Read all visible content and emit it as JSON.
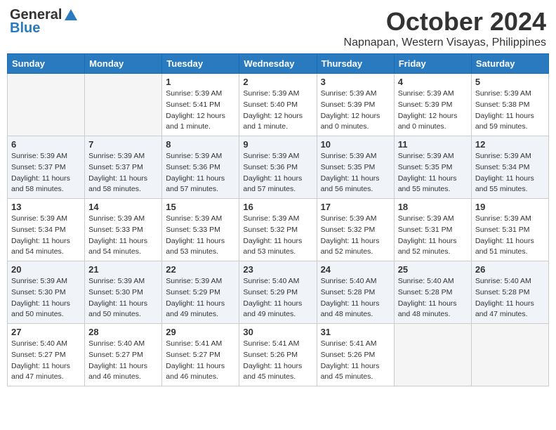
{
  "logo": {
    "line1": "General",
    "line2": "Blue"
  },
  "title": "October 2024",
  "subtitle": "Napnapan, Western Visayas, Philippines",
  "weekdays": [
    "Sunday",
    "Monday",
    "Tuesday",
    "Wednesday",
    "Thursday",
    "Friday",
    "Saturday"
  ],
  "weeks": [
    [
      {
        "day": "",
        "sunrise": "",
        "sunset": "",
        "daylight": ""
      },
      {
        "day": "",
        "sunrise": "",
        "sunset": "",
        "daylight": ""
      },
      {
        "day": "1",
        "sunrise": "Sunrise: 5:39 AM",
        "sunset": "Sunset: 5:41 PM",
        "daylight": "Daylight: 12 hours and 1 minute."
      },
      {
        "day": "2",
        "sunrise": "Sunrise: 5:39 AM",
        "sunset": "Sunset: 5:40 PM",
        "daylight": "Daylight: 12 hours and 1 minute."
      },
      {
        "day": "3",
        "sunrise": "Sunrise: 5:39 AM",
        "sunset": "Sunset: 5:39 PM",
        "daylight": "Daylight: 12 hours and 0 minutes."
      },
      {
        "day": "4",
        "sunrise": "Sunrise: 5:39 AM",
        "sunset": "Sunset: 5:39 PM",
        "daylight": "Daylight: 12 hours and 0 minutes."
      },
      {
        "day": "5",
        "sunrise": "Sunrise: 5:39 AM",
        "sunset": "Sunset: 5:38 PM",
        "daylight": "Daylight: 11 hours and 59 minutes."
      }
    ],
    [
      {
        "day": "6",
        "sunrise": "Sunrise: 5:39 AM",
        "sunset": "Sunset: 5:37 PM",
        "daylight": "Daylight: 11 hours and 58 minutes."
      },
      {
        "day": "7",
        "sunrise": "Sunrise: 5:39 AM",
        "sunset": "Sunset: 5:37 PM",
        "daylight": "Daylight: 11 hours and 58 minutes."
      },
      {
        "day": "8",
        "sunrise": "Sunrise: 5:39 AM",
        "sunset": "Sunset: 5:36 PM",
        "daylight": "Daylight: 11 hours and 57 minutes."
      },
      {
        "day": "9",
        "sunrise": "Sunrise: 5:39 AM",
        "sunset": "Sunset: 5:36 PM",
        "daylight": "Daylight: 11 hours and 57 minutes."
      },
      {
        "day": "10",
        "sunrise": "Sunrise: 5:39 AM",
        "sunset": "Sunset: 5:35 PM",
        "daylight": "Daylight: 11 hours and 56 minutes."
      },
      {
        "day": "11",
        "sunrise": "Sunrise: 5:39 AM",
        "sunset": "Sunset: 5:35 PM",
        "daylight": "Daylight: 11 hours and 55 minutes."
      },
      {
        "day": "12",
        "sunrise": "Sunrise: 5:39 AM",
        "sunset": "Sunset: 5:34 PM",
        "daylight": "Daylight: 11 hours and 55 minutes."
      }
    ],
    [
      {
        "day": "13",
        "sunrise": "Sunrise: 5:39 AM",
        "sunset": "Sunset: 5:34 PM",
        "daylight": "Daylight: 11 hours and 54 minutes."
      },
      {
        "day": "14",
        "sunrise": "Sunrise: 5:39 AM",
        "sunset": "Sunset: 5:33 PM",
        "daylight": "Daylight: 11 hours and 54 minutes."
      },
      {
        "day": "15",
        "sunrise": "Sunrise: 5:39 AM",
        "sunset": "Sunset: 5:33 PM",
        "daylight": "Daylight: 11 hours and 53 minutes."
      },
      {
        "day": "16",
        "sunrise": "Sunrise: 5:39 AM",
        "sunset": "Sunset: 5:32 PM",
        "daylight": "Daylight: 11 hours and 53 minutes."
      },
      {
        "day": "17",
        "sunrise": "Sunrise: 5:39 AM",
        "sunset": "Sunset: 5:32 PM",
        "daylight": "Daylight: 11 hours and 52 minutes."
      },
      {
        "day": "18",
        "sunrise": "Sunrise: 5:39 AM",
        "sunset": "Sunset: 5:31 PM",
        "daylight": "Daylight: 11 hours and 52 minutes."
      },
      {
        "day": "19",
        "sunrise": "Sunrise: 5:39 AM",
        "sunset": "Sunset: 5:31 PM",
        "daylight": "Daylight: 11 hours and 51 minutes."
      }
    ],
    [
      {
        "day": "20",
        "sunrise": "Sunrise: 5:39 AM",
        "sunset": "Sunset: 5:30 PM",
        "daylight": "Daylight: 11 hours and 50 minutes."
      },
      {
        "day": "21",
        "sunrise": "Sunrise: 5:39 AM",
        "sunset": "Sunset: 5:30 PM",
        "daylight": "Daylight: 11 hours and 50 minutes."
      },
      {
        "day": "22",
        "sunrise": "Sunrise: 5:39 AM",
        "sunset": "Sunset: 5:29 PM",
        "daylight": "Daylight: 11 hours and 49 minutes."
      },
      {
        "day": "23",
        "sunrise": "Sunrise: 5:40 AM",
        "sunset": "Sunset: 5:29 PM",
        "daylight": "Daylight: 11 hours and 49 minutes."
      },
      {
        "day": "24",
        "sunrise": "Sunrise: 5:40 AM",
        "sunset": "Sunset: 5:28 PM",
        "daylight": "Daylight: 11 hours and 48 minutes."
      },
      {
        "day": "25",
        "sunrise": "Sunrise: 5:40 AM",
        "sunset": "Sunset: 5:28 PM",
        "daylight": "Daylight: 11 hours and 48 minutes."
      },
      {
        "day": "26",
        "sunrise": "Sunrise: 5:40 AM",
        "sunset": "Sunset: 5:28 PM",
        "daylight": "Daylight: 11 hours and 47 minutes."
      }
    ],
    [
      {
        "day": "27",
        "sunrise": "Sunrise: 5:40 AM",
        "sunset": "Sunset: 5:27 PM",
        "daylight": "Daylight: 11 hours and 47 minutes."
      },
      {
        "day": "28",
        "sunrise": "Sunrise: 5:40 AM",
        "sunset": "Sunset: 5:27 PM",
        "daylight": "Daylight: 11 hours and 46 minutes."
      },
      {
        "day": "29",
        "sunrise": "Sunrise: 5:41 AM",
        "sunset": "Sunset: 5:27 PM",
        "daylight": "Daylight: 11 hours and 46 minutes."
      },
      {
        "day": "30",
        "sunrise": "Sunrise: 5:41 AM",
        "sunset": "Sunset: 5:26 PM",
        "daylight": "Daylight: 11 hours and 45 minutes."
      },
      {
        "day": "31",
        "sunrise": "Sunrise: 5:41 AM",
        "sunset": "Sunset: 5:26 PM",
        "daylight": "Daylight: 11 hours and 45 minutes."
      },
      {
        "day": "",
        "sunrise": "",
        "sunset": "",
        "daylight": ""
      },
      {
        "day": "",
        "sunrise": "",
        "sunset": "",
        "daylight": ""
      }
    ]
  ]
}
